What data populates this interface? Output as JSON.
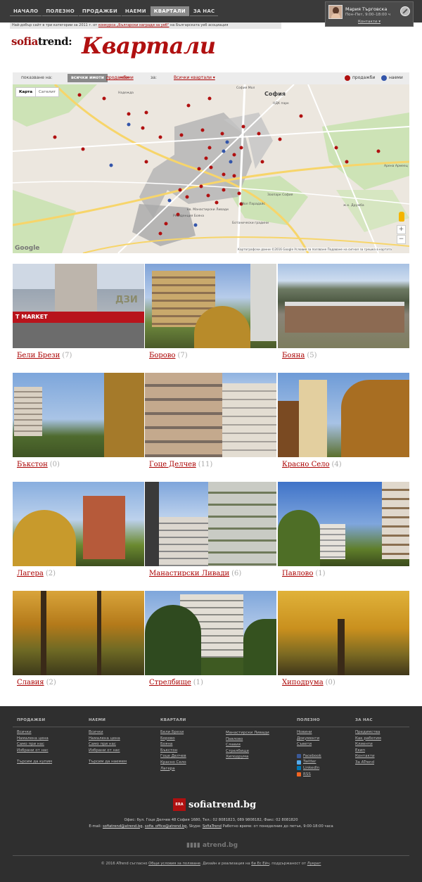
{
  "nav": {
    "items": [
      {
        "label": "НАЧАЛО",
        "active": false
      },
      {
        "label": "ПОЛЕЗНО",
        "active": false
      },
      {
        "label": "ПРОДАЖБИ",
        "active": false
      },
      {
        "label": "НАЕМИ",
        "active": false
      },
      {
        "label": "КВАРТАЛИ",
        "active": true
      },
      {
        "label": "ЗА НАС",
        "active": false
      }
    ]
  },
  "contact": {
    "name": "Мария Търговска",
    "hours": "Пон–Пет, 9:00–18:00 ч",
    "link": "Контакти"
  },
  "award": {
    "pre": "Най-добър сайт в три категории за 2011 г. от ",
    "link": "конкурса „Български награди за уеб“",
    "post": " на Българската уеб асоциация"
  },
  "logo": {
    "part1": "sofia",
    "part2": "trend:"
  },
  "page_title": "Квартали",
  "filter": {
    "show_label": "показване на:",
    "all": "всички имоти",
    "sales": "продажби",
    "rents": "наеми",
    "for_label": "за:",
    "district_select": "Всички квартали ▾",
    "legend_sales": "продажби",
    "legend_rents": "наеми",
    "color_sales": "#b01010",
    "color_rents": "#3355aa"
  },
  "map": {
    "type_map": "Карта",
    "type_sat": "Сателит",
    "city_label": "София",
    "labels": [
      "София Мол",
      "НДК парк",
      "Зоопарк София",
      "Арена Армеец",
      "Ботанически градини",
      "Резиденция Бояна",
      "Мол Парадайс",
      "кв. Манастирски Ливади",
      "Надежда",
      "ж.к. Дружба"
    ],
    "google": "Google",
    "attribution": "Картографски данни ©2016 Google   Условия за ползване   Подаване на сигнал за грешка в картата",
    "zoom_in": "+",
    "zoom_out": "−"
  },
  "districts": [
    {
      "name": "Бели Брези",
      "count": "(7)"
    },
    {
      "name": "Борово",
      "count": "(7)"
    },
    {
      "name": "Бояна",
      "count": "(5)"
    },
    {
      "name": "Бъкстон",
      "count": "(0)"
    },
    {
      "name": "Гоце Делчев",
      "count": "(11)"
    },
    {
      "name": "Красно Село",
      "count": "(4)"
    },
    {
      "name": "Лагера",
      "count": "(2)"
    },
    {
      "name": "Манастирски Ливади",
      "count": "(6)"
    },
    {
      "name": "Павлово",
      "count": "(1)"
    },
    {
      "name": "Славия",
      "count": "(2)"
    },
    {
      "name": "Стрелбище",
      "count": "(1)"
    },
    {
      "name": "Хиподрума",
      "count": "(0)"
    }
  ],
  "tile_texts": {
    "market": "T MARKET",
    "dzi": "ДЗИ"
  },
  "footer": {
    "sales_head": "ПРОДАЖБИ",
    "sales": [
      "Всички",
      "Намалена цена",
      "Само при нас",
      "Избрани от нас",
      "",
      "Търсим да купим"
    ],
    "rents_head": "НАЕМИ",
    "rents": [
      "Всички",
      "Намалена цена",
      "Само при нас",
      "Избрани от нас",
      "",
      "Търсим да наемем"
    ],
    "districts_head": "КВАРТАЛИ",
    "districts_a": [
      "Бели Брези",
      "Борово",
      "Бояна",
      "Бъкстон",
      "Гоце Делчев",
      "Красно Село",
      "Лагера"
    ],
    "districts_b": [
      "Манастирски Ливади",
      "Павлово",
      "Славия",
      "Стрелбище",
      "Хиподрума"
    ],
    "useful_head": "ПОЛЕЗНО",
    "useful": [
      "Новини",
      "Документи",
      "Съвети"
    ],
    "social": [
      {
        "label": "Facebook",
        "color": "#3b5998"
      },
      {
        "label": "Twitter",
        "color": "#55acee"
      },
      {
        "label": "LinkedIn",
        "color": "#0077b5"
      },
      {
        "label": "RSS",
        "color": "#f26522"
      }
    ],
    "about_head": "ЗА НАС",
    "about": [
      "Предимства",
      "Как работим",
      "Клиенти",
      "Екип",
      "Контакти",
      "За ATrend"
    ],
    "era": "ERA",
    "brand": "sofiatrend.bg",
    "office_line1": "Офис: бул. Гоце Делчев 48 София 1680, Тел.: 02 8081823, 089 9808182, Факс: 02 8081820",
    "email_pre": "E-mail: ",
    "email1": "sofiatrend@atrend.bg",
    "email2": "sofia_office@atrend.bg",
    "skype_pre": ", Skype: ",
    "skype": "SofiaTrend",
    "hours": " Работно време: от понеделник до петък, 9:00-18:00 часа",
    "atrend": "atrend.bg",
    "copy_pre": "© 2016 ATrend съгласно ",
    "copy_terms": "Общи условия за ползване",
    "copy_mid": ". Дизайн и реализация на ",
    "copy_design": "би Ес Ейч",
    "copy_mid2": ", поддържаност от ",
    "copy_support": "Лукрат"
  }
}
